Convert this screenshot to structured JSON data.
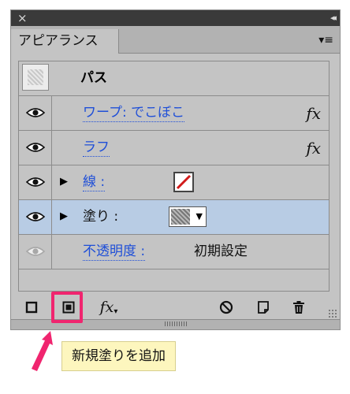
{
  "window": {
    "close_glyph": "×",
    "collapse_glyph": "◂◂"
  },
  "tabs": [
    {
      "label": "アピアランス"
    }
  ],
  "panel_menu_glyph": "▾≡",
  "header_row": {
    "label": "パス"
  },
  "effects": [
    {
      "label": "ワープ: でこぼこ",
      "fx": "fx"
    },
    {
      "label": "ラフ",
      "fx": "fx"
    }
  ],
  "stroke_row": {
    "label": "線 :",
    "swatch_color": "#d11a1a"
  },
  "fill_row": {
    "label": "塗り :",
    "dropdown_glyph": "▼"
  },
  "opacity_row": {
    "label": "不透明度 :",
    "value": "初期設定"
  },
  "toolbar": {
    "fx_label": "fx",
    "fx_caret": "▾"
  },
  "tooltip": {
    "text": "新規塗りを追加"
  },
  "colors": {
    "panel_bg": "#c4c4c4",
    "selected_row": "#b8cce4",
    "link": "#1f4fd8",
    "highlight": "#f0256f",
    "tooltip_bg": "#fdf6be"
  }
}
